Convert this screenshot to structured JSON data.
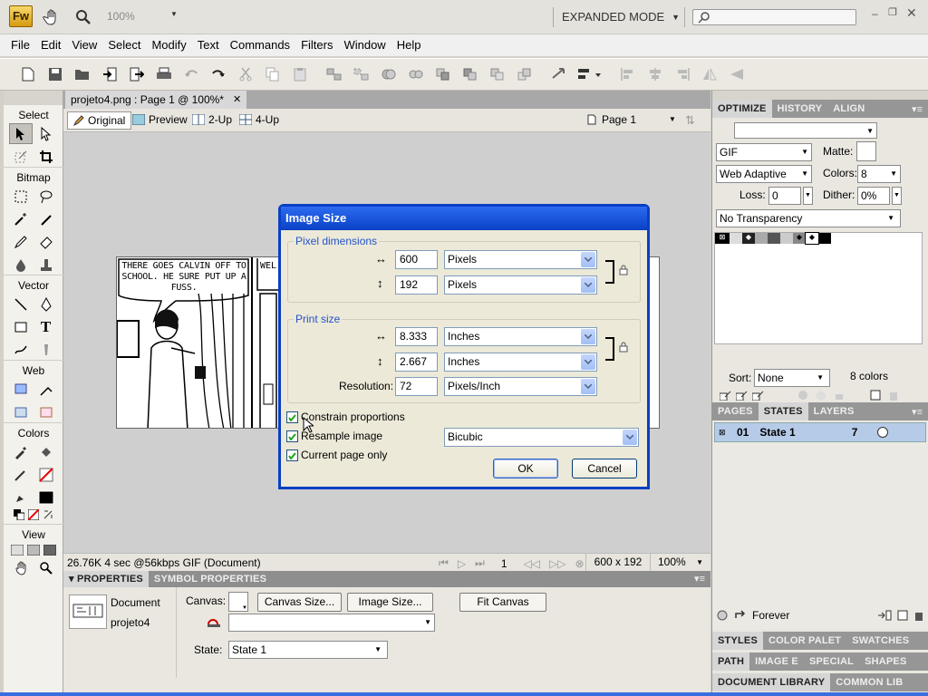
{
  "app": {
    "logo": "Fw",
    "zoom": "100%",
    "mode": "EXPANDED MODE",
    "search_placeholder": ""
  },
  "menu": [
    "File",
    "Edit",
    "View",
    "Select",
    "Modify",
    "Text",
    "Commands",
    "Filters",
    "Window",
    "Help"
  ],
  "tools": {
    "sections": [
      "Select",
      "Bitmap",
      "Vector",
      "Web",
      "Colors",
      "View"
    ]
  },
  "document": {
    "tab_label": "projeto4.png : Page 1 @ 100%*",
    "view_tabs": [
      "Original",
      "Preview",
      "2-Up",
      "4-Up"
    ],
    "page_select": "Page 1",
    "comic_text_1": "THERE GOES CALVIN OFF TO SCHOOL. HE SURE PUT UP A FUSS.",
    "comic_text_2": "WEL"
  },
  "statusbar": {
    "info": "26.76K  4 sec @56kbps  GIF (Document)",
    "frame": "1",
    "dimensions": "600 x 192",
    "zoom": "100%"
  },
  "properties": {
    "tabs": [
      "PROPERTIES",
      "SYMBOL PROPERTIES"
    ],
    "doc_type": "Document",
    "doc_name": "projeto4",
    "canvas_label": "Canvas:",
    "canvas_size_btn": "Canvas Size...",
    "image_size_btn": "Image Size...",
    "fit_canvas_btn": "Fit Canvas",
    "state_label": "State:",
    "state_value": "State 1"
  },
  "optimize": {
    "tabs": [
      "OPTIMIZE",
      "HISTORY",
      "ALIGN"
    ],
    "format": "GIF",
    "matte_label": "Matte:",
    "palette": "Web Adaptive",
    "colors_label": "Colors:",
    "colors_value": "8",
    "loss_label": "Loss:",
    "loss_value": "0",
    "dither_label": "Dither:",
    "dither_value": "0%",
    "transparency": "No Transparency",
    "sort_label": "Sort:",
    "sort_value": "None",
    "colors_count": "8 colors"
  },
  "states": {
    "tabs": [
      "PAGES",
      "STATES",
      "LAYERS"
    ],
    "row_num": "01",
    "row_name": "State 1",
    "row_delay": "7",
    "loop": "Forever"
  },
  "bottom_panels": {
    "row1": [
      "STYLES",
      "COLOR PALET",
      "SWATCHES"
    ],
    "row2": [
      "PATH",
      "IMAGE E",
      "SPECIAL",
      "SHAPES"
    ],
    "row3": [
      "DOCUMENT LIBRARY",
      "COMMON LIB"
    ]
  },
  "dialog": {
    "title": "Image Size",
    "pixel_group": "Pixel dimensions",
    "pixel_width": "600",
    "pixel_height": "192",
    "pixel_unit": "Pixels",
    "print_group": "Print size",
    "print_width": "8.333",
    "print_height": "2.667",
    "print_unit": "Inches",
    "resolution_label": "Resolution:",
    "resolution_value": "72",
    "resolution_unit": "Pixels/Inch",
    "constrain_label": "Constrain proportions",
    "resample_label": "Resample image",
    "resample_method": "Bicubic",
    "current_page_label": "Current page only",
    "ok": "OK",
    "cancel": "Cancel"
  }
}
